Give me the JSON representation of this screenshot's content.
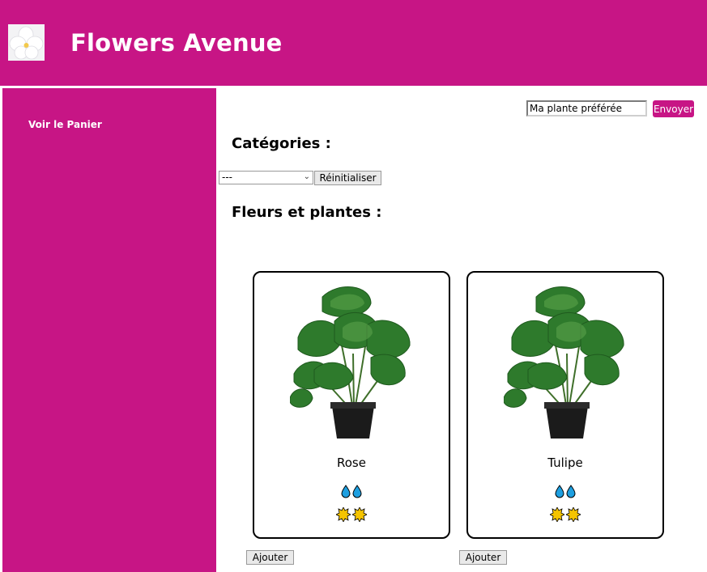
{
  "header": {
    "title": "Flowers Avenue",
    "logo": "white-flower-logo"
  },
  "sidebar": {
    "cart_link": "Voir le Panier"
  },
  "search": {
    "value": "Ma plante préférée",
    "button": "Envoyer"
  },
  "categories": {
    "title": "Catégories :",
    "selected": "---",
    "reset_button": "Réinitialiser"
  },
  "products": {
    "title": "Fleurs et plantes :",
    "items": [
      {
        "name": "Rose",
        "water_level": 2,
        "light_level": 2,
        "add_button": "Ajouter",
        "image": "monstera-plant"
      },
      {
        "name": "Tulipe",
        "water_level": 2,
        "light_level": 2,
        "add_button": "Ajouter",
        "image": "monstera-plant"
      }
    ]
  },
  "colors": {
    "brand": "#c71585",
    "water": "#1e9fe0",
    "sun": "#f5c400"
  }
}
